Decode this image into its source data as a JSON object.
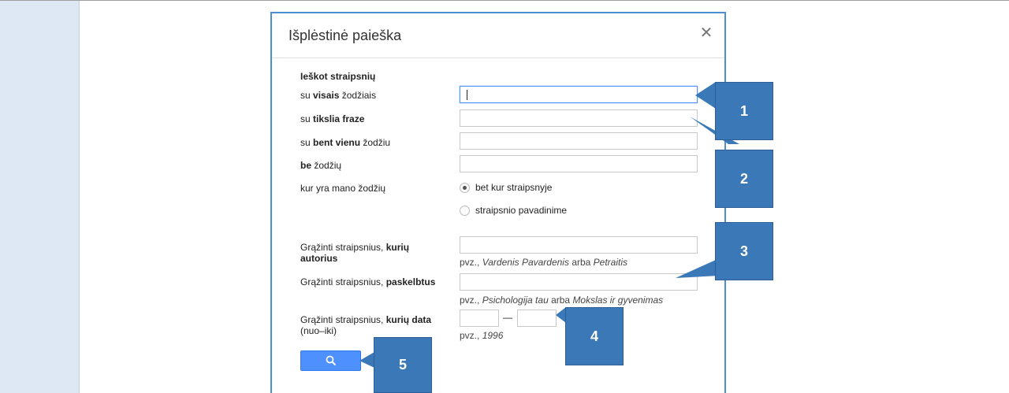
{
  "dialog": {
    "title": "Išplėstinė paieška",
    "close_icon": "close-icon"
  },
  "form": {
    "section_title": "Ieškot straipsnių",
    "all_words": {
      "prefix": "su ",
      "bold": "visais",
      "suffix": " žodžiais",
      "value": ""
    },
    "exact_phrase": {
      "prefix": "su ",
      "bold": "tikslia fraze",
      "suffix": "",
      "value": ""
    },
    "any_word": {
      "prefix": "su ",
      "bold": "bent vienu",
      "suffix": " žodžiu",
      "value": ""
    },
    "without_words": {
      "prefix": "",
      "bold": "be",
      "suffix": " žodžių",
      "value": ""
    },
    "where_label": "kur yra mano žodžių",
    "where_options": [
      {
        "label": "bet kur straipsnyje",
        "selected": true
      },
      {
        "label": "straipsnio pavadinime",
        "selected": false
      }
    ],
    "author": {
      "label_prefix": "Grąžinti straipsnius, ",
      "label_bold1": "kurių",
      "label_bold2": "autorius",
      "value": "",
      "hint_prefix": "pvz., ",
      "hint_italic1": "Vardenis Pavardenis",
      "hint_mid": " arba ",
      "hint_italic2": "Petraitis"
    },
    "published": {
      "label_prefix": "Grąžinti straipsnius, ",
      "label_bold": "paskelbtus",
      "value": "",
      "hint_prefix": "pvz., ",
      "hint_italic1": "Psichologija tau",
      "hint_mid": " arba ",
      "hint_italic2": "Mokslas ir gyvenimas"
    },
    "date": {
      "label_prefix": "Grąžinti straipsnius, ",
      "label_bold": "kurių data",
      "label_line2": "(nuo–iki)",
      "dash": "—",
      "from": "",
      "to": "",
      "hint_prefix": "pvz., ",
      "hint_italic": "1996"
    },
    "search_button_icon": "search-icon"
  },
  "markers": [
    "1",
    "2",
    "3",
    "4",
    "5"
  ],
  "colors": {
    "accent": "#4d90fe",
    "marker": "#3b78b8",
    "dialog_border": "#4d8fd1"
  }
}
